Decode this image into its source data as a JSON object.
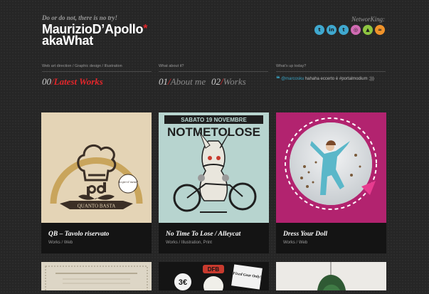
{
  "header": {
    "tagline": "Do or do not, there is no try!",
    "logo_line1": "MaurizioD’Apollo",
    "logo_star": "*",
    "logo_line2": "akaWhat",
    "networking_label": "NetworKing:",
    "social_icons": [
      "twitter-icon",
      "linkedin-icon",
      "tumblr-icon",
      "dribbble-icon",
      "android-icon",
      "rss-icon"
    ]
  },
  "columns": {
    "col1_heading": "Web art direction / Graphic design / Illustration",
    "col2_heading": "What about it?",
    "col3_heading": "What's up today?"
  },
  "nav": {
    "latest_num": "00",
    "latest_label": "Latest Works",
    "about_num": "01",
    "about_label": "About me",
    "works_num": "02",
    "works_label": "Works",
    "sep": "/"
  },
  "tweet": {
    "handle": "@marcosku",
    "text": "hahaha eccerto è #portalmodium ;)))"
  },
  "works": [
    {
      "title": "QB – Tavolo riservato",
      "meta": "Works / Web",
      "logo_text": "QUANTO BASTA",
      "badge": "Scopri il menù!"
    },
    {
      "title": "No Time To Lose / Alleycat",
      "meta": "Works / Illustration, Print",
      "poster_date": "SABATO 19 NOVEMBRE",
      "poster_title": "NOTMETOLOSE"
    },
    {
      "title": "Dress Your Doll",
      "meta": "Works / Web"
    }
  ],
  "row2": {
    "card2_price": "3€",
    "card2_badge": "Fixed Gear Only!",
    "card2_tag": "DFB"
  },
  "colors": {
    "accent": "#e3262b",
    "link": "#38a3c4",
    "bg": "#262626"
  }
}
